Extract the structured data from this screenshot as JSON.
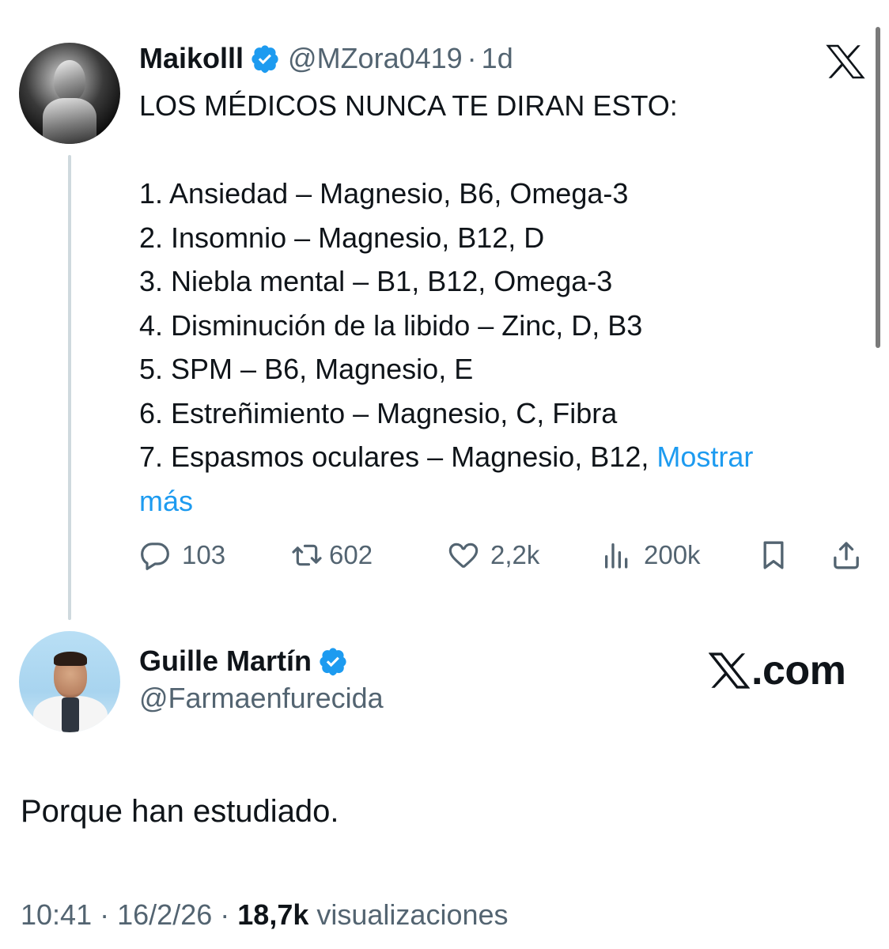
{
  "original_tweet": {
    "display_name": "Maikolll",
    "handle": "@MZora0419",
    "separator": "·",
    "age": "1d",
    "headline": "LOS MÉDICOS NUNCA TE DIRAN ESTO:",
    "items": [
      "1. Ansiedad – Magnesio, B6, Omega-3",
      "2. Insomnio – Magnesio, B12, D",
      "3. Niebla mental – B1, B12, Omega-3",
      "4. Disminución de la libido – Zinc, D, B3",
      "5. SPM – B6, Magnesio, E",
      "6. Estreñimiento – Magnesio, C, Fibra",
      "7. Espasmos oculares – Magnesio, B12, "
    ],
    "show_more_part1": "Mostrar",
    "show_more_part2": "más",
    "stats": {
      "replies": "103",
      "retweets": "602",
      "likes": "2,2k",
      "views": "200k"
    }
  },
  "reply": {
    "display_name": "Guille Martín",
    "handle": "@Farmaenfurecida",
    "brand": ".com",
    "text": "Porque han estudiado.",
    "time": "10:41",
    "date": "16/2/26",
    "sep": "·",
    "views_count": "18,7k",
    "views_label": "visualizaciones"
  },
  "icons": [
    "x-logo-icon",
    "verified-badge-icon",
    "reply-icon",
    "retweet-icon",
    "like-icon",
    "views-icon",
    "bookmark-icon",
    "share-icon"
  ],
  "colors": {
    "text": "#0f1419",
    "secondary": "#536471",
    "link": "#1d9bf0",
    "verified": "#1d9bf0",
    "thread_line": "#cfd9de"
  }
}
